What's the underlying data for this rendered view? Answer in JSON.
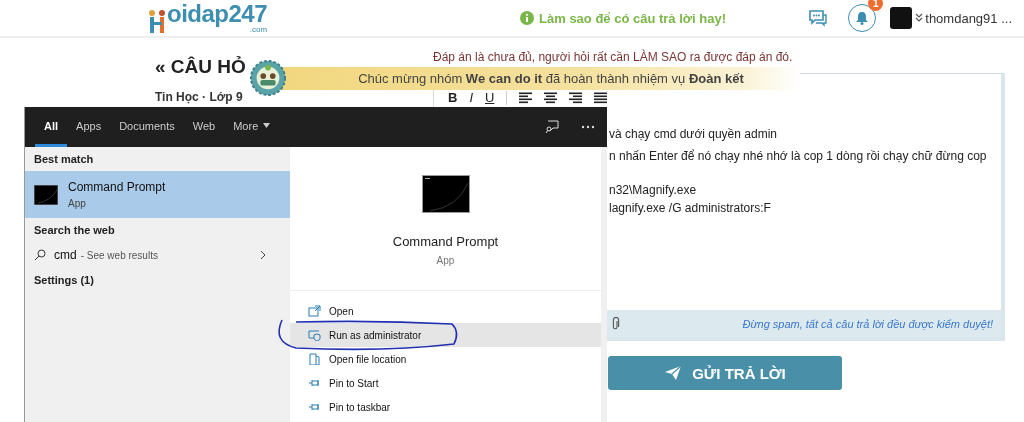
{
  "header": {
    "logo_text": "oidap247",
    "logo_suffix": ".com",
    "tip": "Làm sao để có câu trả lời hay!",
    "notification_count": "1",
    "username": "thomdang91 ..."
  },
  "question": {
    "title": "« CÂU HỎ",
    "subject": "Tin Học · Lớp 9"
  },
  "banner": {
    "message": "Chúc mừng nhóm **We can do it** đã hoàn thành nhiệm vụ **Đoàn kết**"
  },
  "answer": {
    "hint": "Đáp án là chưa đủ, người hỏi rất cần LÀM SAO ra được đáp án đó.",
    "toolbar": [
      {
        "kind": "bold",
        "label": "B"
      },
      {
        "kind": "italic",
        "label": "I"
      },
      {
        "kind": "underline",
        "label": "U"
      },
      {
        "kind": "align-left"
      },
      {
        "kind": "align-center"
      },
      {
        "kind": "align-right"
      },
      {
        "kind": "justify"
      }
    ],
    "paragraphs": [
      [
        "và chạy cmd dưới quyền admin",
        "n nhấn Enter để nó chạy nhé nhớ là cop 1 dòng rồi chạy chữ đừng cop"
      ],
      [
        "n32\\Magnify.exe",
        "lagnify.exe /G administrators:F"
      ]
    ],
    "note": "Đừng spam, tất cả câu trả lời đều được kiểm duyệt!",
    "submit": "GỬI TRẢ LỜI"
  },
  "search_window": {
    "tabs": [
      {
        "label": "All",
        "selected": true
      },
      {
        "label": "Apps",
        "selected": false
      },
      {
        "label": "Documents",
        "selected": false
      },
      {
        "label": "Web",
        "selected": false
      },
      {
        "label": "More",
        "selected": false
      }
    ],
    "best_match_heading": "Best match",
    "best_match": {
      "title": "Command Prompt",
      "subtitle": "App",
      "selected": true
    },
    "web_heading": "Search the web",
    "web_query": "cmd",
    "web_hint": "- See web results",
    "settings": "Settings (1)",
    "preview": {
      "title": "Command Prompt",
      "subtitle": "App"
    },
    "actions": [
      {
        "kind": "open",
        "label": "Open",
        "selected": false
      },
      {
        "kind": "admin",
        "label": "Run as administrator",
        "selected": true
      },
      {
        "kind": "location",
        "label": "Open file location",
        "selected": false
      },
      {
        "kind": "pin",
        "label": "Pin to Start",
        "selected": false
      },
      {
        "kind": "pin",
        "label": "Pin to taskbar",
        "selected": false
      }
    ]
  }
}
